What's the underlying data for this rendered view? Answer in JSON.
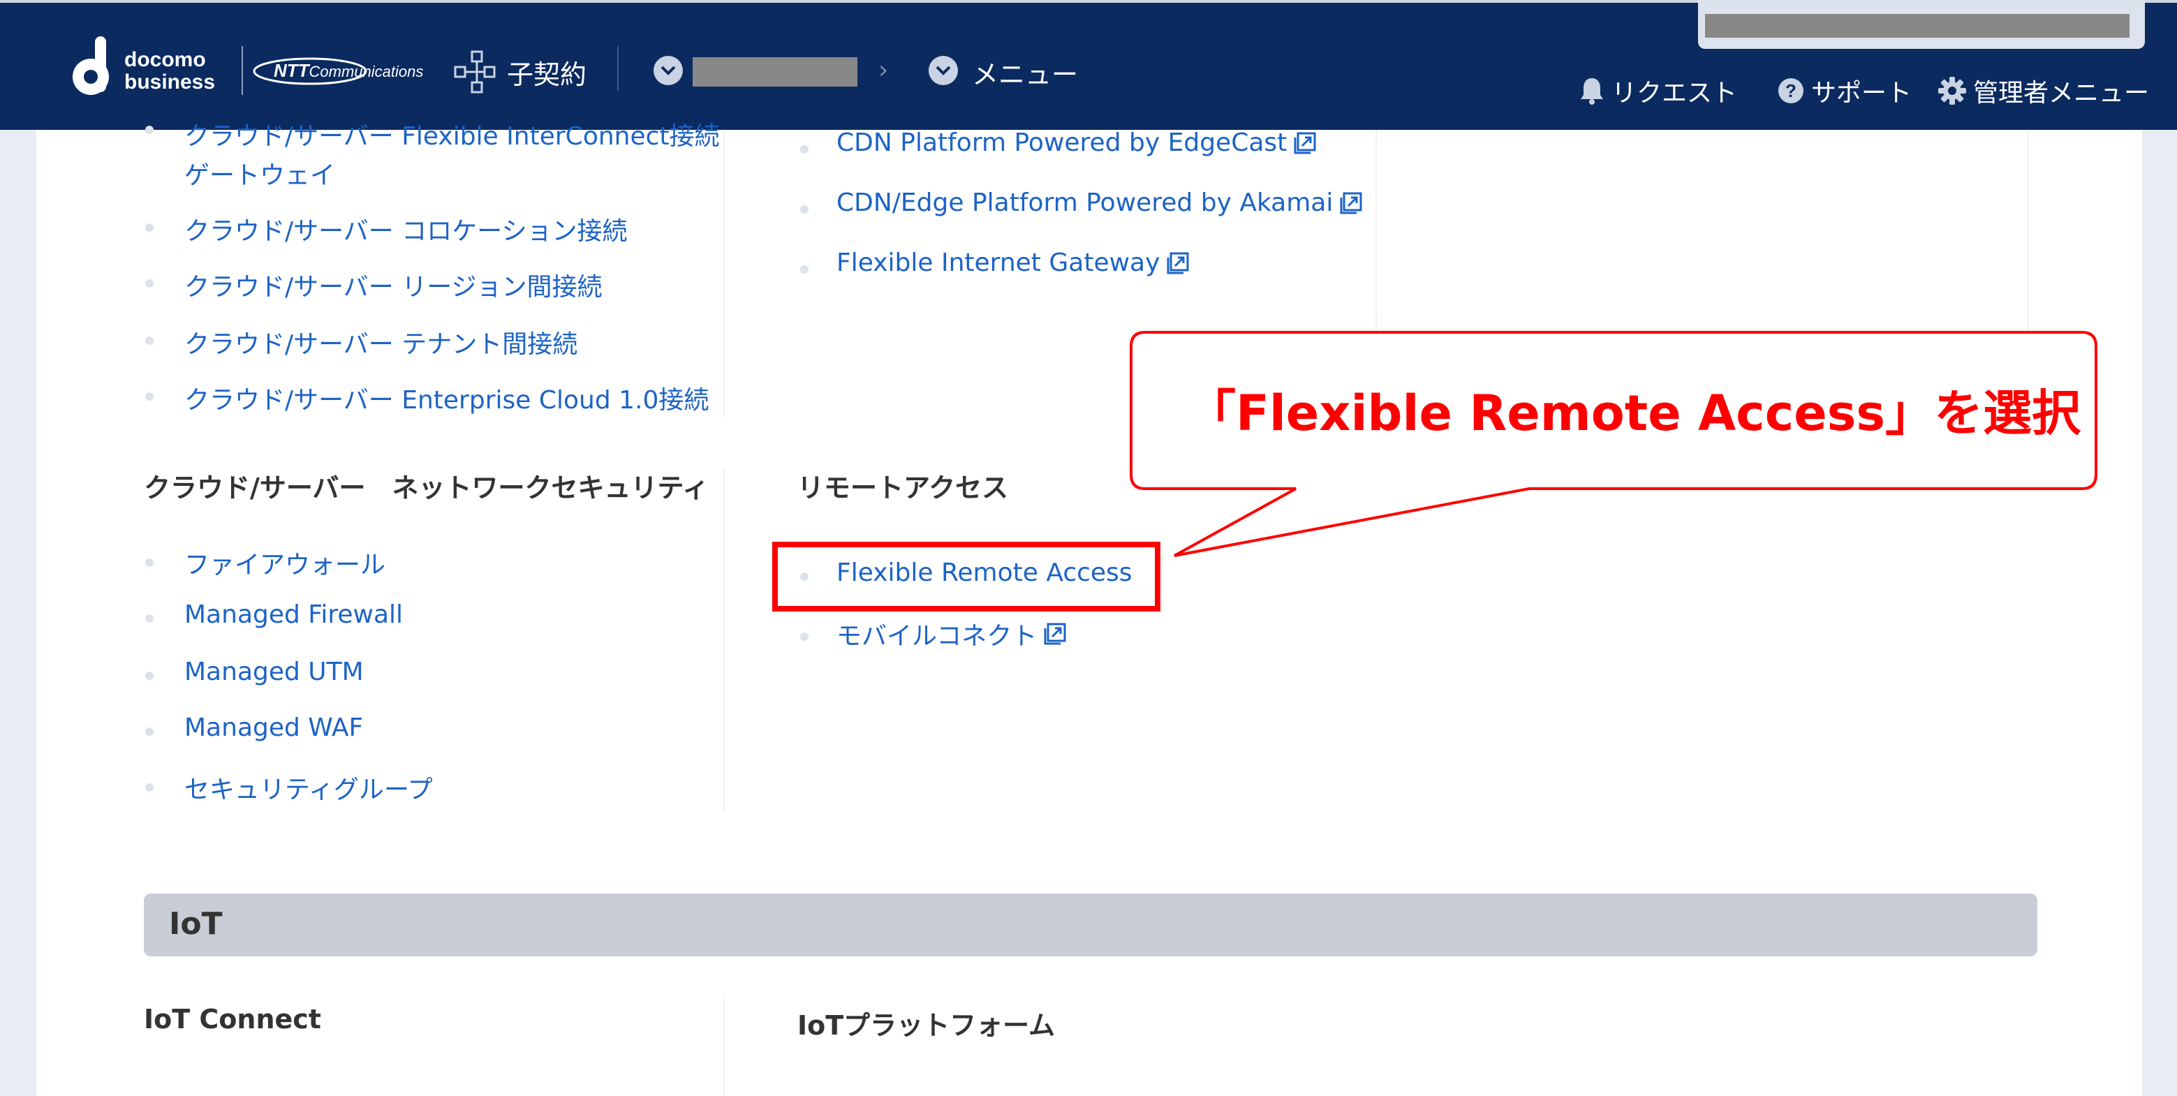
{
  "header": {
    "logo": {
      "line1": "docomo",
      "line2": "business"
    },
    "partner_logo": {
      "brand": "NTT",
      "suffix": "Communications"
    },
    "contract_label": "子契約",
    "menu_label": "メニュー",
    "nav": {
      "request": "リクエスト",
      "support": "サポート",
      "admin_menu": "管理者メニュー"
    },
    "colors": {
      "background": "#0b2a5f",
      "text": "#ffffff"
    }
  },
  "top_items_left": [
    {
      "label": "クラウド/サーバー Flexible InterConnect接続"
    },
    {
      "label": "ゲートウェイ"
    },
    {
      "label": "クラウド/サーバー コロケーション接続"
    },
    {
      "label": "クラウド/サーバー リージョン間接続"
    },
    {
      "label": "クラウド/サーバー テナント間接続"
    },
    {
      "label": "クラウド/サーバー Enterprise Cloud 1.0接続"
    }
  ],
  "top_items_mid": [
    {
      "label": "CDN Platform Powered by EdgeCast"
    },
    {
      "label": "CDN/Edge Platform Powered by Akamai"
    },
    {
      "label": "Flexible Internet Gateway"
    }
  ],
  "categories": {
    "network_security": "クラウド/サーバー　ネットワークセキュリティ",
    "remote_access": "リモートアクセス",
    "iot_connect": "IoT Connect",
    "iot_platform": "IoTプラットフォーム"
  },
  "security_items": [
    {
      "label": "ファイアウォール"
    },
    {
      "label": "Managed Firewall"
    },
    {
      "label": "Managed UTM"
    },
    {
      "label": "Managed WAF"
    },
    {
      "label": "セキュリティグループ"
    }
  ],
  "remote_items": [
    {
      "label": "Flexible Remote Access"
    },
    {
      "label": "モバイルコネクト"
    }
  ],
  "iot_section_title": "IoT",
  "callout": {
    "text": "「Flexible Remote Access」を選択",
    "color": "#ff0000"
  },
  "link_color": "#1c63c6"
}
